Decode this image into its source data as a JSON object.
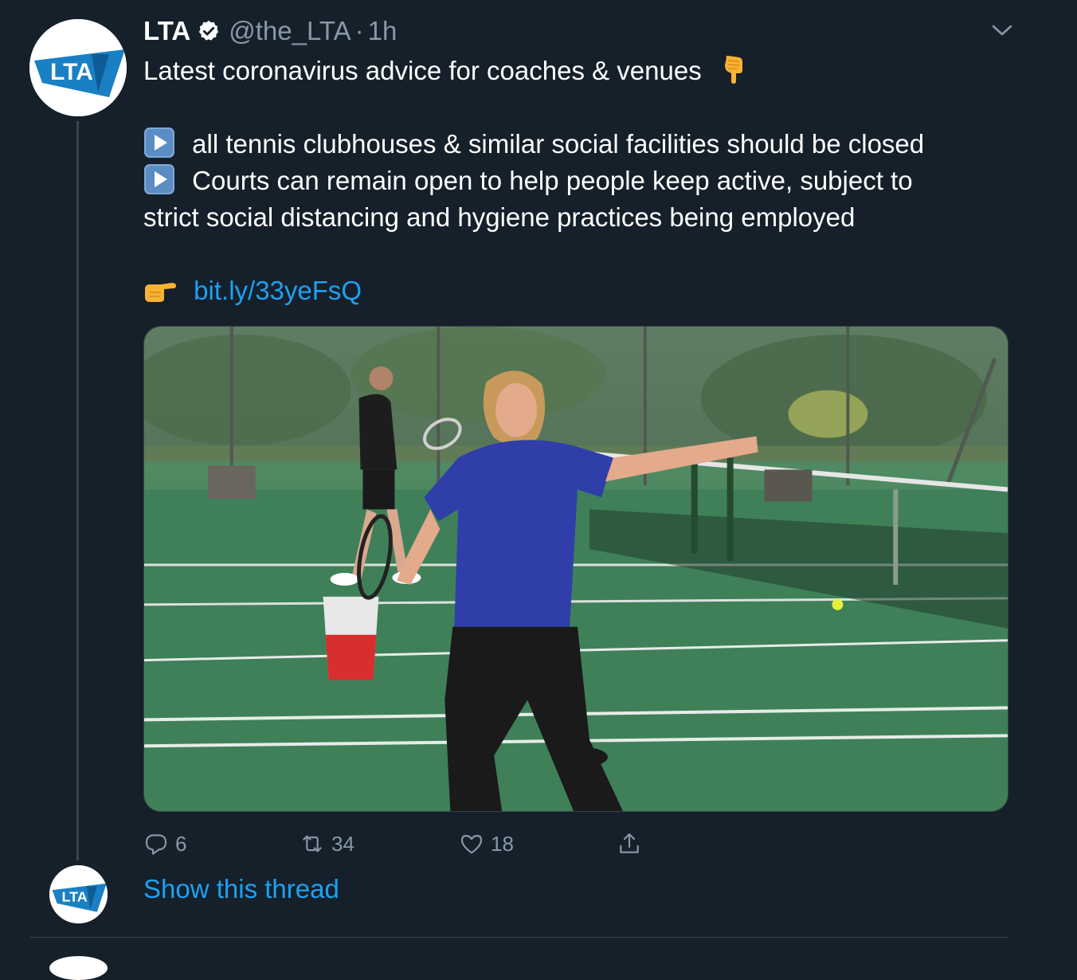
{
  "tweet": {
    "author_name": "LTA",
    "handle": "@the_LTA",
    "separator": "·",
    "time": "1h",
    "avatar_logo": "LTA",
    "lines": {
      "l1": "Latest coronavirus advice for coaches & venues",
      "l2": "all tennis clubhouses & similar social facilities should be closed",
      "l3": "Courts can remain open to help people keep active, subject to",
      "l4": "strict social distancing and hygiene practices being employed"
    },
    "link": "bit.ly/33yeFsQ",
    "emoji": {
      "l1": "backhand-index-pointing-down",
      "bullet": "play-button",
      "link": "backhand-index-pointing-right"
    },
    "actions": {
      "reply_count": "6",
      "retweet_count": "34",
      "like_count": "18"
    },
    "show_thread": "Show this thread"
  },
  "colors": {
    "background": "#15202b",
    "accent": "#1da1f2",
    "muted": "#8899a6",
    "divider": "#38444d"
  },
  "icons": {
    "verified": "verified-badge-icon",
    "caret": "chevron-down-icon",
    "reply": "reply-icon",
    "retweet": "retweet-icon",
    "like": "heart-icon",
    "share": "share-icon"
  }
}
